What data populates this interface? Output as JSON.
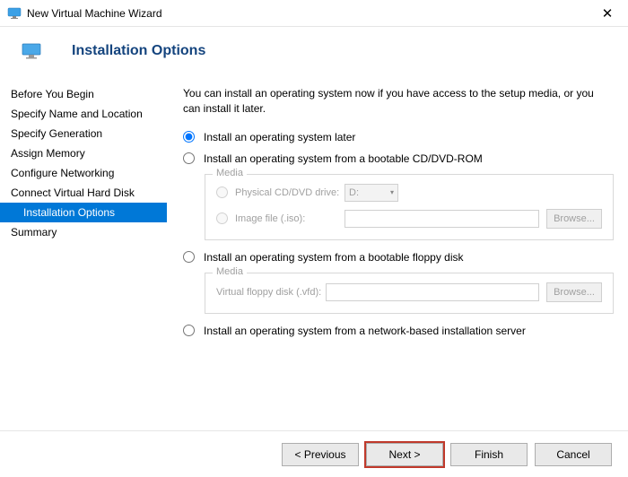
{
  "window": {
    "title": "New Virtual Machine Wizard"
  },
  "header": {
    "title": "Installation Options"
  },
  "sidebar": {
    "items": [
      {
        "label": "Before You Begin"
      },
      {
        "label": "Specify Name and Location"
      },
      {
        "label": "Specify Generation"
      },
      {
        "label": "Assign Memory"
      },
      {
        "label": "Configure Networking"
      },
      {
        "label": "Connect Virtual Hard Disk"
      },
      {
        "label": "Installation Options"
      },
      {
        "label": "Summary"
      }
    ]
  },
  "main": {
    "intro": "You can install an operating system now if you have access to the setup media, or you can install it later.",
    "options": {
      "later": "Install an operating system later",
      "cddvd": "Install an operating system from a bootable CD/DVD-ROM",
      "floppy": "Install an operating system from a bootable floppy disk",
      "network": "Install an operating system from a network-based installation server"
    },
    "media": {
      "legend": "Media",
      "physical_drive_label": "Physical CD/DVD drive:",
      "physical_drive_value": "D:",
      "image_file_label": "Image file (.iso):",
      "floppy_label": "Virtual floppy disk (.vfd):",
      "browse": "Browse..."
    }
  },
  "footer": {
    "previous": "< Previous",
    "next": "Next >",
    "finish": "Finish",
    "cancel": "Cancel"
  }
}
